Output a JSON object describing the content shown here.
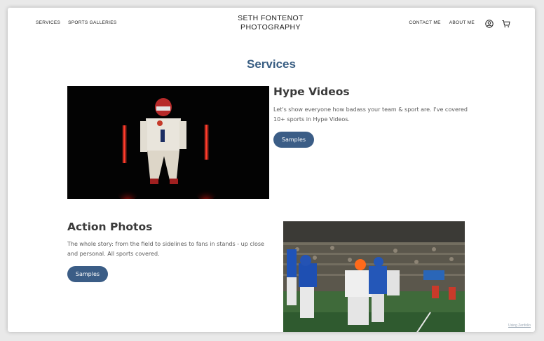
{
  "header": {
    "nav_left": [
      {
        "label": "SERVICES"
      },
      {
        "label": "SPORTS GALLERIES"
      }
    ],
    "brand": {
      "line1": "SETH FONTENOT",
      "line2": "PHOTOGRAPHY"
    },
    "nav_right": [
      {
        "label": "CONTACT ME"
      },
      {
        "label": "ABOUT ME"
      }
    ],
    "icons": [
      "account-icon",
      "cart-icon"
    ]
  },
  "page_title": "Services",
  "sections": [
    {
      "title": "Hype Videos",
      "description_line1": "Let's show everyone how badass your team & sport are. I've covered",
      "description_line2": "10+ sports in Hype Videos.",
      "button_label": "Samples"
    },
    {
      "title": "Action Photos",
      "description_line1": "The whole story: from the field to sidelines to fans in stands - up close",
      "description_line2": "and personal. All sports covered.",
      "button_label": "Samples"
    }
  ],
  "footer_note": "Using Zenfolio",
  "colors": {
    "accent": "#385d82",
    "button": "#3b5d86",
    "text_dark": "#3a3a3a"
  }
}
